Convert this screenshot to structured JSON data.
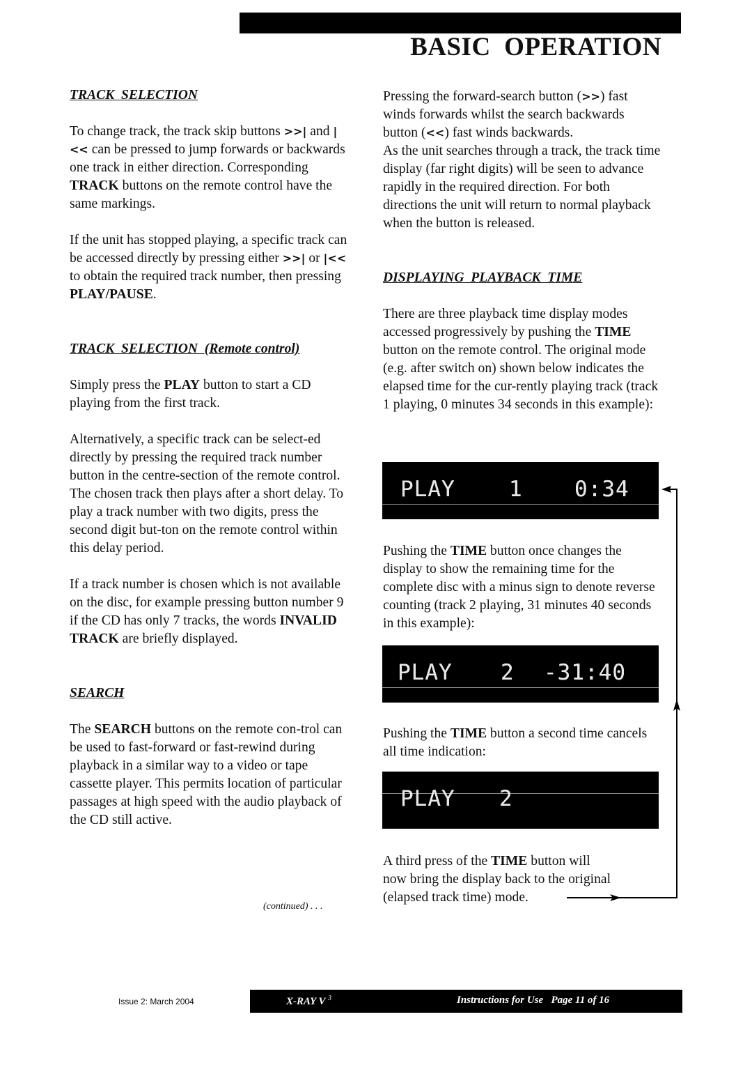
{
  "header": {
    "title": "BASIC  OPERATION"
  },
  "left_column": {
    "track_selection": {
      "heading": "TRACK  SELECTION",
      "p1": [
        {
          "t": "To change track, the track skip buttons  "
        },
        {
          "s": ">>|"
        },
        {
          "t": " and  "
        },
        {
          "s": "|<<"
        },
        {
          "t": "  can be pressed to jump forwards or backwards one track in either direction. Corresponding "
        },
        {
          "b": "TRACK"
        },
        {
          "t": " buttons on the remote control have the same markings."
        }
      ],
      "p2": [
        {
          "t": "If the unit has stopped playing, a specific track can be accessed directly by pressing either  "
        },
        {
          "s": ">>|"
        },
        {
          "t": "  or  "
        },
        {
          "s": "|<<"
        },
        {
          "t": "  to obtain the required track number, then pressing "
        },
        {
          "b": "PLAY/PAUSE"
        },
        {
          "t": "."
        }
      ]
    },
    "track_selection_remote": {
      "heading": "TRACK  SELECTION  (Remote control)",
      "p1": [
        {
          "t": "Simply press the "
        },
        {
          "b": "PLAY"
        },
        {
          "t": " button to start a CD playing from the first track."
        }
      ],
      "p2": [
        {
          "t": "Alternatively, a specific track can be select-ed directly by pressing the required track number button in the centre-section of the remote control.  The chosen track then plays after a short delay.  To play a track number with two digits, press the second digit but-ton on the remote control within this delay period."
        }
      ],
      "p3": [
        {
          "t": "If a track number is chosen which is not available on the disc, for example pressing button number 9 if the CD has only 7 tracks, the words "
        },
        {
          "b": "INVALID TRACK"
        },
        {
          "t": " are briefly displayed."
        }
      ]
    },
    "search": {
      "heading": "SEARCH",
      "p1": [
        {
          "t": "The "
        },
        {
          "b": "SEARCH"
        },
        {
          "t": " buttons on the remote con-trol can be used to fast-forward or fast-rewind during playback in a similar way to a video or tape cassette player.  This permits location of particular passages at high speed with the audio playback of the CD still active."
        }
      ]
    },
    "continued": "(continued) . . ."
  },
  "right_column": {
    "search_cont": {
      "p1": [
        {
          "t": "Pressing the forward-search button  ("
        },
        {
          "s": ">>"
        },
        {
          "t": ") fast winds forwards whilst the search backwards button  ("
        },
        {
          "s": "<<"
        },
        {
          "t": ")  fast winds backwards."
        }
      ],
      "p2": [
        {
          "t": "As the unit searches through a track, the track time display (far right digits) will be seen to advance rapidly in the required direction.  For both directions the unit will return to normal playback when the button is released."
        }
      ]
    },
    "displaying_playback_time": {
      "heading": "DISPLAYING  PLAYBACK  TIME",
      "p1": [
        {
          "t": "There are three playback time display modes accessed progressively by pushing the "
        },
        {
          "b": "TIME"
        },
        {
          "t": " button on the remote control. The original mode (e.g. after switch on) shown below indicates the elapsed time for the cur-rently playing track (track 1 playing, 0 minutes 34 seconds in this example):"
        }
      ],
      "p2": [
        {
          "t": "Pushing the "
        },
        {
          "b": "TIME"
        },
        {
          "t": " button once changes the display to show the remaining time for the complete disc with a minus sign to denote reverse counting (track 2 playing, 31 minutes 40 seconds in this example):"
        }
      ],
      "p3": [
        {
          "t": "Pushing the "
        },
        {
          "b": "TIME"
        },
        {
          "t": " button a second time cancels all time indication:"
        }
      ],
      "p4": [
        {
          "t": "A third press of the "
        },
        {
          "b": "TIME"
        },
        {
          "t": " button will now bring the display back to the original (elapsed track time) mode."
        }
      ]
    },
    "displays": [
      {
        "mode": "PLAY",
        "track": "1",
        "time": "0:34"
      },
      {
        "mode": "PLAY",
        "track": "2",
        "time": "-31:40"
      },
      {
        "mode": "PLAY",
        "track": "2",
        "time": ""
      }
    ]
  },
  "footer": {
    "issue": "Issue 2:  March 2004",
    "model": "X-RAY V",
    "model_sup": "3",
    "page": "Instructions for Use   Page 11 of 16"
  }
}
